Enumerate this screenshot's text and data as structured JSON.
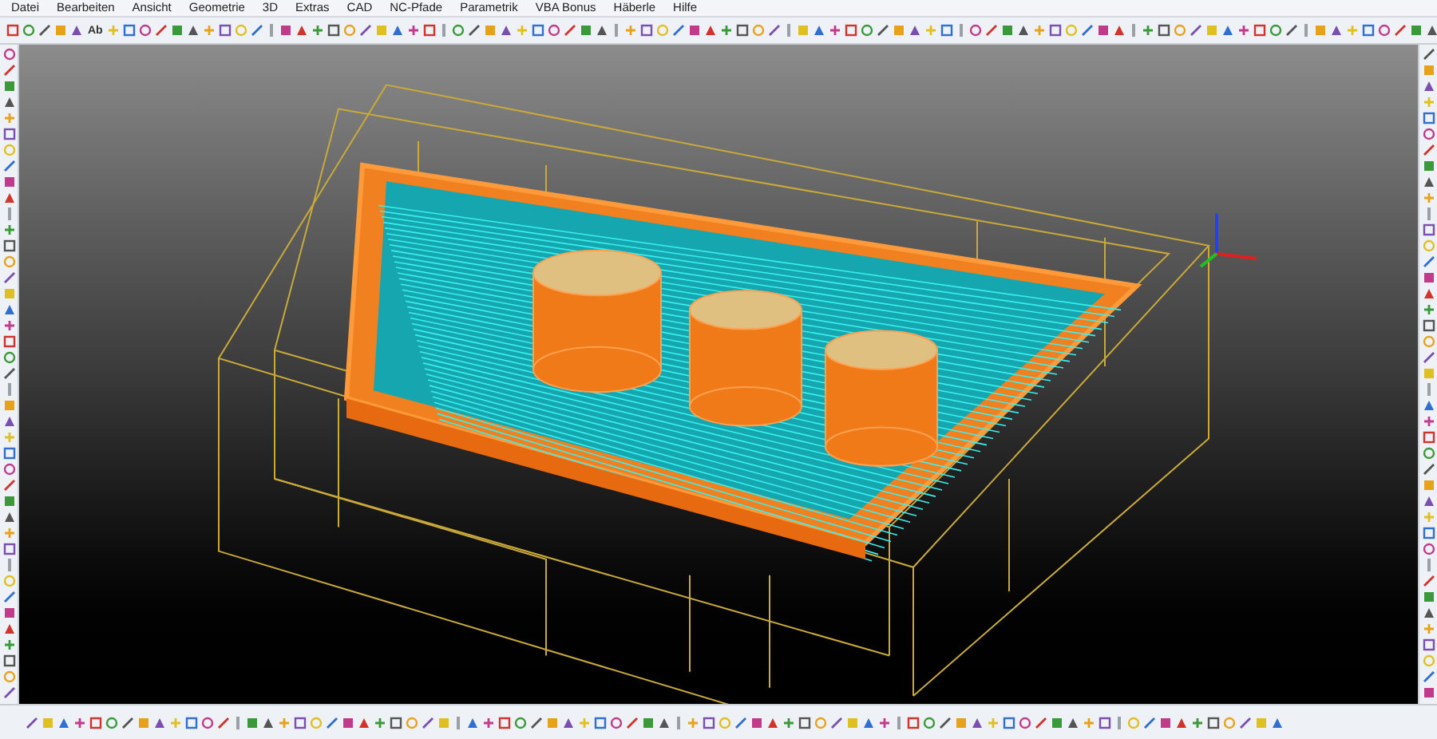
{
  "menu_bar": {
    "items": [
      "Datei",
      "Bearbeiten",
      "Ansicht",
      "Geometrie",
      "3D",
      "Extras",
      "CAD",
      "NC-Pfade",
      "Parametrik",
      "VBA Bonus",
      "Häberle",
      "Hilfe"
    ]
  },
  "top_toolbar": {
    "text_button": "Ab"
  }
}
